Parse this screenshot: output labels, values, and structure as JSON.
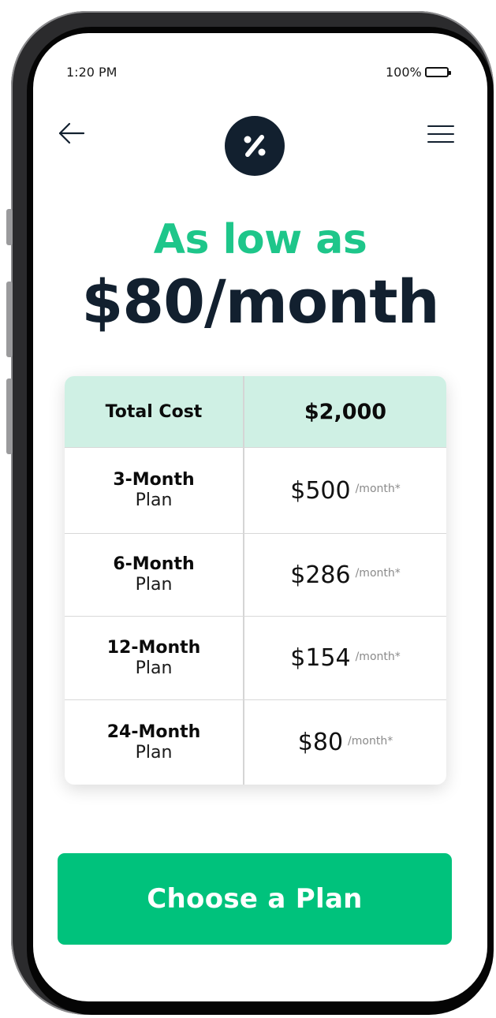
{
  "status_bar": {
    "time": "1:20 PM",
    "battery": "100%"
  },
  "nav": {
    "back_icon": "arrow-left-icon",
    "menu_icon": "hamburger-menu-icon",
    "logo_icon": "percent-icon",
    "logo_color": "#12202f"
  },
  "hero": {
    "line1": "As low as",
    "line2": "$80/month",
    "accent_color": "#1ec68a"
  },
  "table": {
    "header": {
      "label": "Total Cost",
      "value": "$2,000"
    },
    "rows": [
      {
        "plan": "3-Month",
        "plan_suffix": "Plan",
        "price": "$500",
        "unit": "/month*"
      },
      {
        "plan": "6-Month",
        "plan_suffix": "Plan",
        "price": "$286",
        "unit": "/month*"
      },
      {
        "plan": "12-Month",
        "plan_suffix": "Plan",
        "price": "$154",
        "unit": "/month*"
      },
      {
        "plan": "24-Month",
        "plan_suffix": "Plan",
        "price": "$80",
        "unit": "/month*"
      }
    ],
    "header_bg": "#cff0e4"
  },
  "cta": {
    "label": "Choose a Plan",
    "color": "#00c27c"
  }
}
